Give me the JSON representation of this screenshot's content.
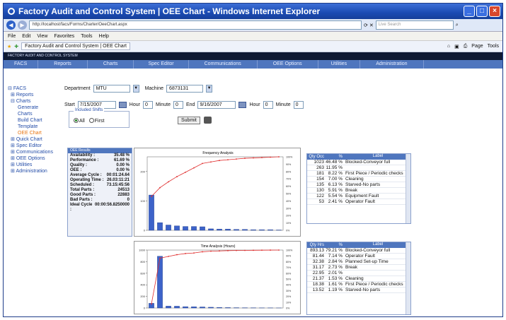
{
  "window": {
    "title": "Factory Audit and Control System | OEE Chart - Windows Internet Explorer"
  },
  "browser": {
    "address": "http://localhost/facs/Forms/Charter/OeeChart.aspx",
    "search_placeholder": "Live Search",
    "menu": [
      "File",
      "Edit",
      "View",
      "Favorites",
      "Tools",
      "Help"
    ],
    "tab_label": "Factory Audit and Control System | OEE Chart",
    "toolbar_right": [
      "Page",
      "Tools"
    ]
  },
  "app": {
    "header": "FACTORY AUDIT AND CONTROL SYSTEM",
    "nav": [
      "FACS",
      "Reports",
      "Charts",
      "Spec Editor",
      "Communications",
      "OEE Options",
      "Utilities",
      "Administration"
    ]
  },
  "tree": {
    "root": "FACS",
    "reports": "Reports",
    "charts": "Charts",
    "generate_charts": "Generate Charts",
    "build_chart_template": "Build Chart Template",
    "oee_chart": "OEE Chart",
    "quick_chart": "Quick Chart",
    "spec_editor": "Spec Editor",
    "communications": "Communications",
    "oee_options": "OEE Options",
    "utilities": "Utilities",
    "administration": "Administration"
  },
  "form": {
    "department_label": "Department",
    "department_value": "MTU",
    "machine_label": "Machine",
    "machine_value": "6873131",
    "start_label": "Start",
    "start_value": "7/15/2007",
    "hour_label": "Hour",
    "start_hour": "0",
    "minute_label": "Minute",
    "start_minute": "0",
    "end_label": "End",
    "end_value": "9/16/2007",
    "end_hour": "0",
    "end_minute": "0",
    "shifts_legend": "Included Shifts",
    "shift_all": "All",
    "shift_first": "First",
    "submit": "Submit"
  },
  "results": {
    "header": "OEE Results",
    "rows": [
      {
        "label": "Availability :",
        "value": "35.48 %"
      },
      {
        "label": "Performance :",
        "value": "61.69 %"
      },
      {
        "label": "Quality :",
        "value": "0.00 %"
      },
      {
        "label": "OEE :",
        "value": "0.00 %"
      },
      {
        "label": "Average Cycle :",
        "value": "00:01:24.64"
      },
      {
        "label": "Operating Time :",
        "value": "26.03:11:21"
      },
      {
        "label": "Scheduled :",
        "value": "73.15:45:56"
      },
      {
        "label": "Total Parts :",
        "value": "24513"
      },
      {
        "label": "Good Parts :",
        "value": "22883"
      },
      {
        "label": "Bad Parts :",
        "value": "0"
      },
      {
        "label": "Ideal Cycle :",
        "value": "00:00:56.8250000"
      }
    ]
  },
  "grid1": {
    "headers": [
      "Qty Occ",
      "%",
      "Label"
    ],
    "rows": [
      {
        "qty": "1023",
        "pct": "46.48 %",
        "label": "Blocked-Conveyor full"
      },
      {
        "qty": "263",
        "pct": "11.95 %",
        "label": ""
      },
      {
        "qty": "181",
        "pct": "8.22 %",
        "label": "First Piece / Periodic checks"
      },
      {
        "qty": "154",
        "pct": "7.00 %",
        "label": "Cleaning"
      },
      {
        "qty": "135",
        "pct": "6.13 %",
        "label": "Starved-No parts"
      },
      {
        "qty": "130",
        "pct": "5.91 %",
        "label": "Break"
      },
      {
        "qty": "122",
        "pct": "5.54 %",
        "label": "Equipment Fault"
      },
      {
        "qty": "53",
        "pct": "2.41 %",
        "label": "Operator Fault"
      }
    ]
  },
  "grid2": {
    "headers": [
      "Qty Hrs",
      "%",
      "Label"
    ],
    "rows": [
      {
        "qty": "893.13",
        "pct": "79.21 %",
        "label": "Blocked-Conveyor full"
      },
      {
        "qty": "81.44",
        "pct": "7.14 %",
        "label": "Operator Fault"
      },
      {
        "qty": "32.38",
        "pct": "2.84 %",
        "label": "Planned Set-up Time"
      },
      {
        "qty": "31.17",
        "pct": "2.73 %",
        "label": "Break"
      },
      {
        "qty": "22.95",
        "pct": "2.01 %",
        "label": ""
      },
      {
        "qty": "21.37",
        "pct": "1.53 %",
        "label": "Cleaning"
      },
      {
        "qty": "18.38",
        "pct": "1.61 %",
        "label": "First Piece / Periodic checks"
      },
      {
        "qty": "13.52",
        "pct": "1.19 %",
        "label": "Starved-No parts"
      }
    ]
  },
  "chart_data": [
    {
      "type": "bar",
      "title": "Frequency Analysis",
      "y_ticks": [
        "0",
        "100",
        "200"
      ],
      "y2_ticks": [
        "0%",
        "10%",
        "20%",
        "30%",
        "40%",
        "50%",
        "60%",
        "70%",
        "80%",
        "90%",
        "100%"
      ],
      "ylim": [
        0,
        250
      ],
      "values": [
        120,
        26,
        18,
        15,
        13,
        13,
        12,
        5,
        4,
        4,
        3,
        3,
        2,
        2,
        2,
        1
      ],
      "cumulative_pct": [
        46,
        58,
        66,
        73,
        79,
        85,
        91,
        93,
        95,
        96,
        97,
        98,
        98.5,
        99,
        99.5,
        100
      ]
    },
    {
      "type": "bar",
      "title": "Time Analysis (Hours)",
      "y_ticks": [
        "0",
        "200",
        "400",
        "600",
        "800",
        "1000"
      ],
      "y2_ticks": [
        "0%",
        "10%",
        "20%",
        "30%",
        "40%",
        "50%",
        "60%",
        "70%",
        "80%",
        "90%",
        "100%"
      ],
      "ylim": [
        0,
        1000
      ],
      "values": [
        81,
        893,
        32,
        31,
        23,
        21,
        18,
        13,
        9,
        7,
        5,
        4,
        3,
        2,
        2,
        1
      ],
      "cumulative_pct": [
        7,
        86,
        89,
        92,
        94,
        95,
        97,
        98,
        98.5,
        99,
        99.2,
        99.4,
        99.6,
        99.8,
        99.9,
        100
      ]
    }
  ]
}
